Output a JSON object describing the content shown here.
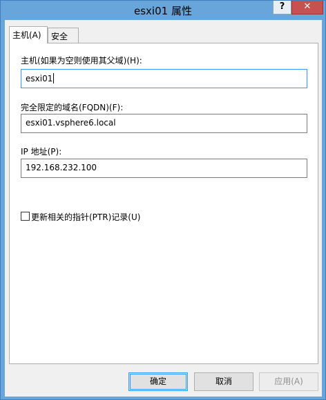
{
  "window": {
    "title": "esxi01 属性",
    "help_label": "?",
    "close_label": "✕"
  },
  "tabs": [
    {
      "label": "主机(A)",
      "active": true
    },
    {
      "label": "安全",
      "active": false
    }
  ],
  "form": {
    "host_label": "主机(如果为空则使用其父域)(H):",
    "host_value": "esxi01",
    "fqdn_label": "完全限定的域名(FQDN)(F):",
    "fqdn_value": "esxi01.vsphere6.local",
    "ip_label": "IP 地址(P):",
    "ip_value": "192.168.232.100",
    "ptr_label": "更新相关的指针(PTR)记录(U)",
    "ptr_checked": false
  },
  "buttons": {
    "ok": "确定",
    "cancel": "取消",
    "apply": "应用(A)"
  }
}
